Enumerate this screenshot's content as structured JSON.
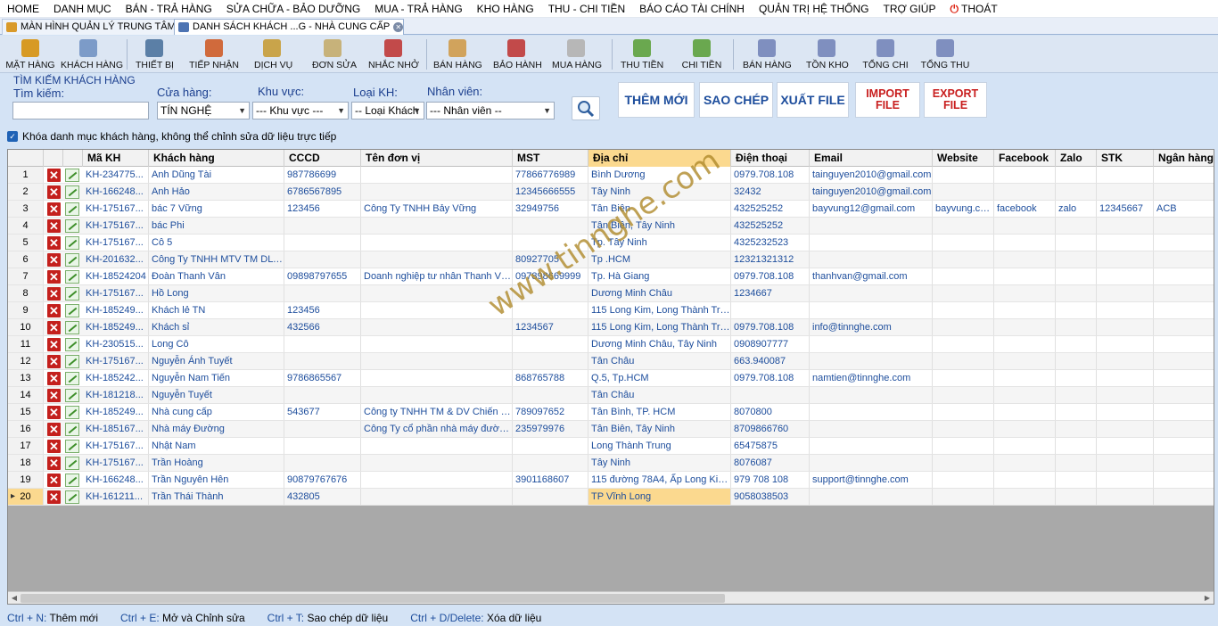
{
  "menu": [
    "HOME",
    "DANH MỤC",
    "BÁN - TRẢ HÀNG",
    "SỬA CHỮA - BẢO DƯỠNG",
    "MUA - TRẢ HÀNG",
    "KHO HÀNG",
    "THU - CHI TIỀN",
    "BÁO CÁO TÀI CHÍNH",
    "QUẢN TRỊ HỆ THỐNG",
    "TRỢ GIÚP",
    "THOÁT"
  ],
  "tabs": [
    {
      "label": "MÀN HÌNH QUẢN LÝ TRUNG TÂM",
      "active": false,
      "icon": "monitor-icon"
    },
    {
      "label": "DANH SÁCH KHÁCH ...G - NHÀ CUNG CẤP",
      "active": true,
      "icon": "list-icon"
    }
  ],
  "toolbar": [
    {
      "label": "MẶT HÀNG",
      "icon": "box-icon",
      "color": "#d79a24"
    },
    {
      "label": "KHÁCH HÀNG",
      "icon": "customer-icon",
      "color": "#7c9bc8"
    },
    {
      "label": "THIẾT BỊ",
      "icon": "device-icon",
      "color": "#5b7fa6"
    },
    {
      "label": "TIẾP NHẬN",
      "icon": "receive-icon",
      "color": "#d06a3c"
    },
    {
      "label": "DỊCH VỤ",
      "icon": "tools-icon",
      "color": "#c9a44a"
    },
    {
      "label": "ĐƠN SỬA",
      "icon": "repair-order-icon",
      "color": "#c7b27a"
    },
    {
      "label": "NHẮC NHỞ",
      "icon": "calendar-icon",
      "color": "#c24a4a"
    },
    {
      "label": "BÁN HÀNG",
      "icon": "sale-icon",
      "color": "#d1a35c"
    },
    {
      "label": "BẢO HÀNH",
      "icon": "warranty-icon",
      "color": "#c24a4a"
    },
    {
      "label": "MUA HÀNG",
      "icon": "cart-icon",
      "color": "#b7b7b7"
    },
    {
      "label": "THU TIỀN",
      "icon": "money-in-icon",
      "color": "#6aa84f"
    },
    {
      "label": "CHI TIỀN",
      "icon": "money-out-icon",
      "color": "#6aa84f"
    },
    {
      "label": "BÁN HÀNG",
      "icon": "sales-report-icon",
      "color": "#7f8fbf"
    },
    {
      "label": "TỒN KHO",
      "icon": "stock-report-icon",
      "color": "#7f8fbf"
    },
    {
      "label": "TỔNG CHI",
      "icon": "expense-report-icon",
      "color": "#7f8fbf"
    },
    {
      "label": "TỔNG THU",
      "icon": "income-report-icon",
      "color": "#7f8fbf"
    }
  ],
  "search": {
    "section_title": "TÌM KIẾM KHÁCH HÀNG",
    "keyword_label": "Tìm kiếm:",
    "keyword_value": "",
    "store_label": "Cửa hàng:",
    "store_value": "TÍN NGHỆ",
    "area_label": "Khu vực:",
    "area_value": "--- Khu vực ---",
    "type_label": "Loại KH:",
    "type_value": "-- Loại Khách",
    "staff_label": "Nhân viên:",
    "staff_value": "--- Nhân viên --"
  },
  "actions": {
    "add": "THÊM MỚI",
    "copy": "SAO CHÉP",
    "export": "XUẤT FILE",
    "import_file": "IMPORT\nFILE",
    "export_file": "EXPORT\nFILE"
  },
  "lock_label": "Khóa danh mục khách hàng, không thể chỉnh sửa dữ liệu trực tiếp",
  "columns": [
    "Mã KH",
    "Khách hàng",
    "CCCD",
    "Tên đơn vị",
    "MST",
    "Địa chỉ",
    "Điện thoại",
    "Email",
    "Website",
    "Facebook",
    "Zalo",
    "STK",
    "Ngân hàng"
  ],
  "rows": [
    {
      "n": "1",
      "code": "KH-234775...",
      "name": "Anh Dũng Tài",
      "cccd": "987786699",
      "unit": "",
      "mst": "77866776989",
      "addr": "Bình Dương",
      "phone": "0979.708.108",
      "email": "tainguyen2010@gmail.com",
      "web": "",
      "fb": "",
      "zalo": "",
      "stk": "",
      "bank": ""
    },
    {
      "n": "2",
      "code": "KH-166248...",
      "name": "Anh Hảo",
      "cccd": "6786567895",
      "unit": "",
      "mst": "12345666555",
      "addr": "Tây Ninh",
      "phone": "32432",
      "email": "tainguyen2010@gmail.com",
      "web": "",
      "fb": "",
      "zalo": "",
      "stk": "",
      "bank": ""
    },
    {
      "n": "3",
      "code": "KH-175167...",
      "name": "bác 7 Vững",
      "cccd": "123456",
      "unit": "Công Ty TNHH Bảy Vững",
      "mst": "32949756",
      "addr": "Tân Biên",
      "phone": "432525252",
      "email": "bayvung12@gmail.com",
      "web": "bayvung.co...",
      "fb": "facebook",
      "zalo": "zalo",
      "stk": "12345667",
      "bank": "ACB"
    },
    {
      "n": "4",
      "code": "KH-175167...",
      "name": "bác Phi",
      "cccd": "",
      "unit": "",
      "mst": "",
      "addr": "Tân Biên, Tây Ninh",
      "phone": "432525252",
      "email": "",
      "web": "",
      "fb": "",
      "zalo": "",
      "stk": "",
      "bank": ""
    },
    {
      "n": "5",
      "code": "KH-175167...",
      "name": "Cô 5",
      "cccd": "",
      "unit": "",
      "mst": "",
      "addr": "Tp. Tây Ninh",
      "phone": "4325232523",
      "email": "",
      "web": "",
      "fb": "",
      "zalo": "",
      "stk": "",
      "bank": ""
    },
    {
      "n": "6",
      "code": "KH-201632...",
      "name": "Công Ty TNHH MTV TM DL K...",
      "cccd": "",
      "unit": "",
      "mst": "80927705",
      "addr": "Tp .HCM",
      "phone": "12321321312",
      "email": "",
      "web": "",
      "fb": "",
      "zalo": "",
      "stk": "",
      "bank": ""
    },
    {
      "n": "7",
      "code": "KH-18524204",
      "name": "Đoàn Thanh Vân",
      "cccd": "09898797655",
      "unit": "Doanh nghiệp tư nhân Thanh Vân",
      "mst": "097898669999",
      "addr": "Tp. Hà Giang",
      "phone": "0979.708.108",
      "email": "thanhvan@gmail.com",
      "web": "",
      "fb": "",
      "zalo": "",
      "stk": "",
      "bank": ""
    },
    {
      "n": "8",
      "code": "KH-175167...",
      "name": "Hồ Long",
      "cccd": "",
      "unit": "",
      "mst": "",
      "addr": "Dương Minh Châu",
      "phone": "1234667",
      "email": "",
      "web": "",
      "fb": "",
      "zalo": "",
      "stk": "",
      "bank": ""
    },
    {
      "n": "9",
      "code": "KH-185249...",
      "name": "Khách lẻ TN",
      "cccd": "123456",
      "unit": "",
      "mst": "",
      "addr": "115 Long Kim, Long Thành Tru...",
      "phone": "",
      "email": "",
      "web": "",
      "fb": "",
      "zalo": "",
      "stk": "",
      "bank": ""
    },
    {
      "n": "10",
      "code": "KH-185249...",
      "name": "Khách sỉ",
      "cccd": "432566",
      "unit": "",
      "mst": "1234567",
      "addr": "115 Long Kim, Long Thành Tru...",
      "phone": "0979.708.108",
      "email": "info@tinnghe.com",
      "web": "",
      "fb": "",
      "zalo": "",
      "stk": "",
      "bank": ""
    },
    {
      "n": "11",
      "code": "KH-230515...",
      "name": "Long Cô",
      "cccd": "",
      "unit": "",
      "mst": "",
      "addr": "Dương Minh Châu, Tây Ninh",
      "phone": "0908907777",
      "email": "",
      "web": "",
      "fb": "",
      "zalo": "",
      "stk": "",
      "bank": ""
    },
    {
      "n": "12",
      "code": "KH-175167...",
      "name": "Nguyễn Ánh Tuyết",
      "cccd": "",
      "unit": "",
      "mst": "",
      "addr": "Tân Châu",
      "phone": "663.940087",
      "email": "",
      "web": "",
      "fb": "",
      "zalo": "",
      "stk": "",
      "bank": ""
    },
    {
      "n": "13",
      "code": "KH-185242...",
      "name": "Nguyễn Nam Tiến",
      "cccd": "9786865567",
      "unit": "",
      "mst": "868765788",
      "addr": "Q.5, Tp.HCM",
      "phone": "0979.708.108",
      "email": "namtien@tinnghe.com",
      "web": "",
      "fb": "",
      "zalo": "",
      "stk": "",
      "bank": ""
    },
    {
      "n": "14",
      "code": "KH-181218...",
      "name": "Nguyễn Tuyết",
      "cccd": "",
      "unit": "",
      "mst": "",
      "addr": "Tân Châu",
      "phone": "",
      "email": "",
      "web": "",
      "fb": "",
      "zalo": "",
      "stk": "",
      "bank": ""
    },
    {
      "n": "15",
      "code": "KH-185249...",
      "name": "Nhà cung cấp",
      "cccd": "543677",
      "unit": "Công ty TNHH TM & DV Chiến Hữu",
      "mst": "789097652",
      "addr": "Tân Bình, TP. HCM",
      "phone": "8070800",
      "email": "",
      "web": "",
      "fb": "",
      "zalo": "",
      "stk": "",
      "bank": ""
    },
    {
      "n": "16",
      "code": "KH-185167...",
      "name": "Nhà máy Đường",
      "cccd": "",
      "unit": "Công Ty cổ phần nhà máy đường ...",
      "mst": "235979976",
      "addr": "Tân Biên, Tây Ninh",
      "phone": "8709866760",
      "email": "",
      "web": "",
      "fb": "",
      "zalo": "",
      "stk": "",
      "bank": ""
    },
    {
      "n": "17",
      "code": "KH-175167...",
      "name": "Nhật Nam",
      "cccd": "",
      "unit": "",
      "mst": "",
      "addr": "Long Thành Trung",
      "phone": "65475875",
      "email": "",
      "web": "",
      "fb": "",
      "zalo": "",
      "stk": "",
      "bank": ""
    },
    {
      "n": "18",
      "code": "KH-175167...",
      "name": "Trần Hoàng",
      "cccd": "",
      "unit": "",
      "mst": "",
      "addr": "Tây Ninh",
      "phone": "8076087",
      "email": "",
      "web": "",
      "fb": "",
      "zalo": "",
      "stk": "",
      "bank": ""
    },
    {
      "n": "19",
      "code": "KH-166248...",
      "name": "Trần Nguyên Hên",
      "cccd": "90879767676",
      "unit": "",
      "mst": "3901168607",
      "addr": "115 đường 78A4, Ấp Long Kim,...",
      "phone": "979 708 108",
      "email": "support@tinnghe.com",
      "web": "",
      "fb": "",
      "zalo": "",
      "stk": "",
      "bank": ""
    },
    {
      "n": "20",
      "code": "KH-161211...",
      "name": "Trần Thái Thành",
      "cccd": "432805",
      "unit": "",
      "mst": "",
      "addr": "TP Vĩnh Long",
      "phone": "9058038503",
      "email": "",
      "web": "",
      "fb": "",
      "zalo": "",
      "stk": "",
      "bank": ""
    }
  ],
  "current_row_marker": "▸",
  "watermark": "www.tinnghe.com",
  "status_hints": [
    {
      "key": "Ctrl + N:",
      "text": "Thêm mới"
    },
    {
      "key": "Ctrl + E:",
      "text": "Mở và Chỉnh sửa"
    },
    {
      "key": "Ctrl + T:",
      "text": "Sao chép dữ liệu"
    },
    {
      "key": "Ctrl + D/Delete:",
      "text": "Xóa dữ liệu"
    }
  ],
  "colors": {
    "accent": "#1d4d9c",
    "delete": "#c4201d",
    "highlight": "#fbd98f",
    "import_export": "#c81e1e"
  }
}
